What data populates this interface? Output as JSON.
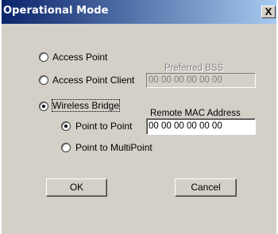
{
  "window": {
    "title": "Operational Mode",
    "close_glyph": "X"
  },
  "modes": {
    "access_point": "Access Point",
    "access_point_client": "Access Point Client",
    "wireless_bridge": "Wireless Bridge",
    "point_to_point": "Point to Point",
    "point_to_multipoint": "Point to MultiPoint"
  },
  "selected": {
    "mode": "Wireless Bridge",
    "bridge_type": "Point to Point"
  },
  "preferred_bss": {
    "label": "Preferred BSS",
    "value": "00 00 00 00 00 00"
  },
  "remote_mac": {
    "label": "Remote MAC Address",
    "value": "00 00 00 00 00 00"
  },
  "buttons": {
    "ok": "OK",
    "cancel": "Cancel"
  },
  "colors": {
    "titlebar_start": "#0a246a",
    "titlebar_end": "#a6caf0",
    "dialog_bg": "#d4d0c8"
  }
}
